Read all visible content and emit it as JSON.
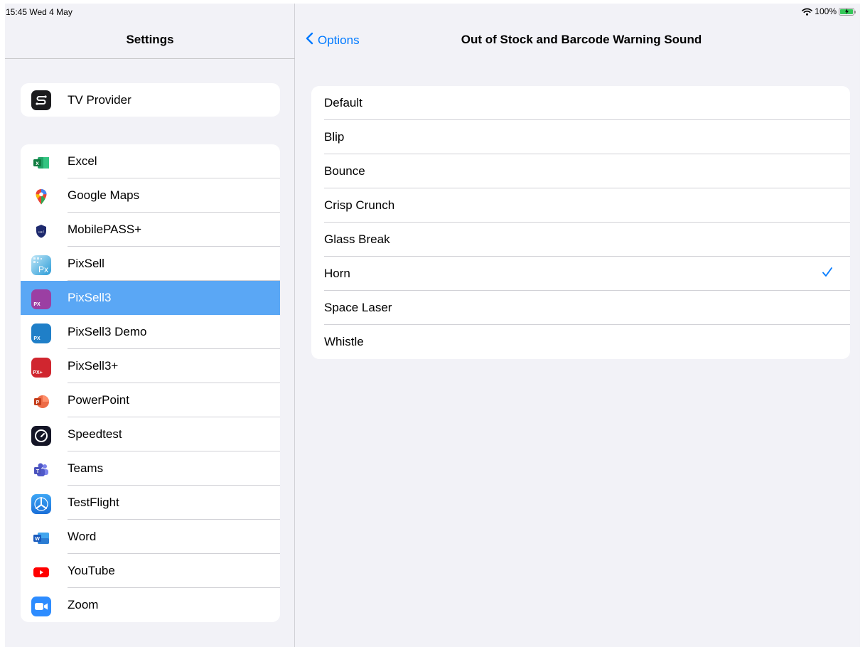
{
  "status": {
    "time": "15:45  Wed 4 May",
    "battery": "100%"
  },
  "sidebar": {
    "title": "Settings",
    "group1": [
      {
        "label": "TV Provider",
        "icon": "tv-provider-icon"
      }
    ],
    "group2": [
      {
        "label": "Excel",
        "icon": "excel-icon"
      },
      {
        "label": "Google Maps",
        "icon": "google-maps-icon"
      },
      {
        "label": "MobilePASS+",
        "icon": "mobilepass-icon"
      },
      {
        "label": "PixSell",
        "icon": "pixsell-icon"
      },
      {
        "label": "PixSell3",
        "icon": "pixsell3-icon",
        "selected": true
      },
      {
        "label": "PixSell3 Demo",
        "icon": "pixsell3-demo-icon"
      },
      {
        "label": "PixSell3+",
        "icon": "pixsell3-plus-icon"
      },
      {
        "label": "PowerPoint",
        "icon": "powerpoint-icon"
      },
      {
        "label": "Speedtest",
        "icon": "speedtest-icon"
      },
      {
        "label": "Teams",
        "icon": "teams-icon"
      },
      {
        "label": "TestFlight",
        "icon": "testflight-icon"
      },
      {
        "label": "Word",
        "icon": "word-icon"
      },
      {
        "label": "YouTube",
        "icon": "youtube-icon"
      },
      {
        "label": "Zoom",
        "icon": "zoom-icon"
      }
    ]
  },
  "detail": {
    "back_label": "Options",
    "title": "Out of Stock and Barcode Warning Sound",
    "options": [
      {
        "label": "Default"
      },
      {
        "label": "Blip"
      },
      {
        "label": "Bounce"
      },
      {
        "label": "Crisp Crunch"
      },
      {
        "label": "Glass Break"
      },
      {
        "label": "Horn",
        "checked": true
      },
      {
        "label": "Space Laser"
      },
      {
        "label": "Whistle"
      }
    ]
  },
  "colors": {
    "accent": "#007aff",
    "selection": "#5aa7f5",
    "background": "#f2f2f7"
  }
}
